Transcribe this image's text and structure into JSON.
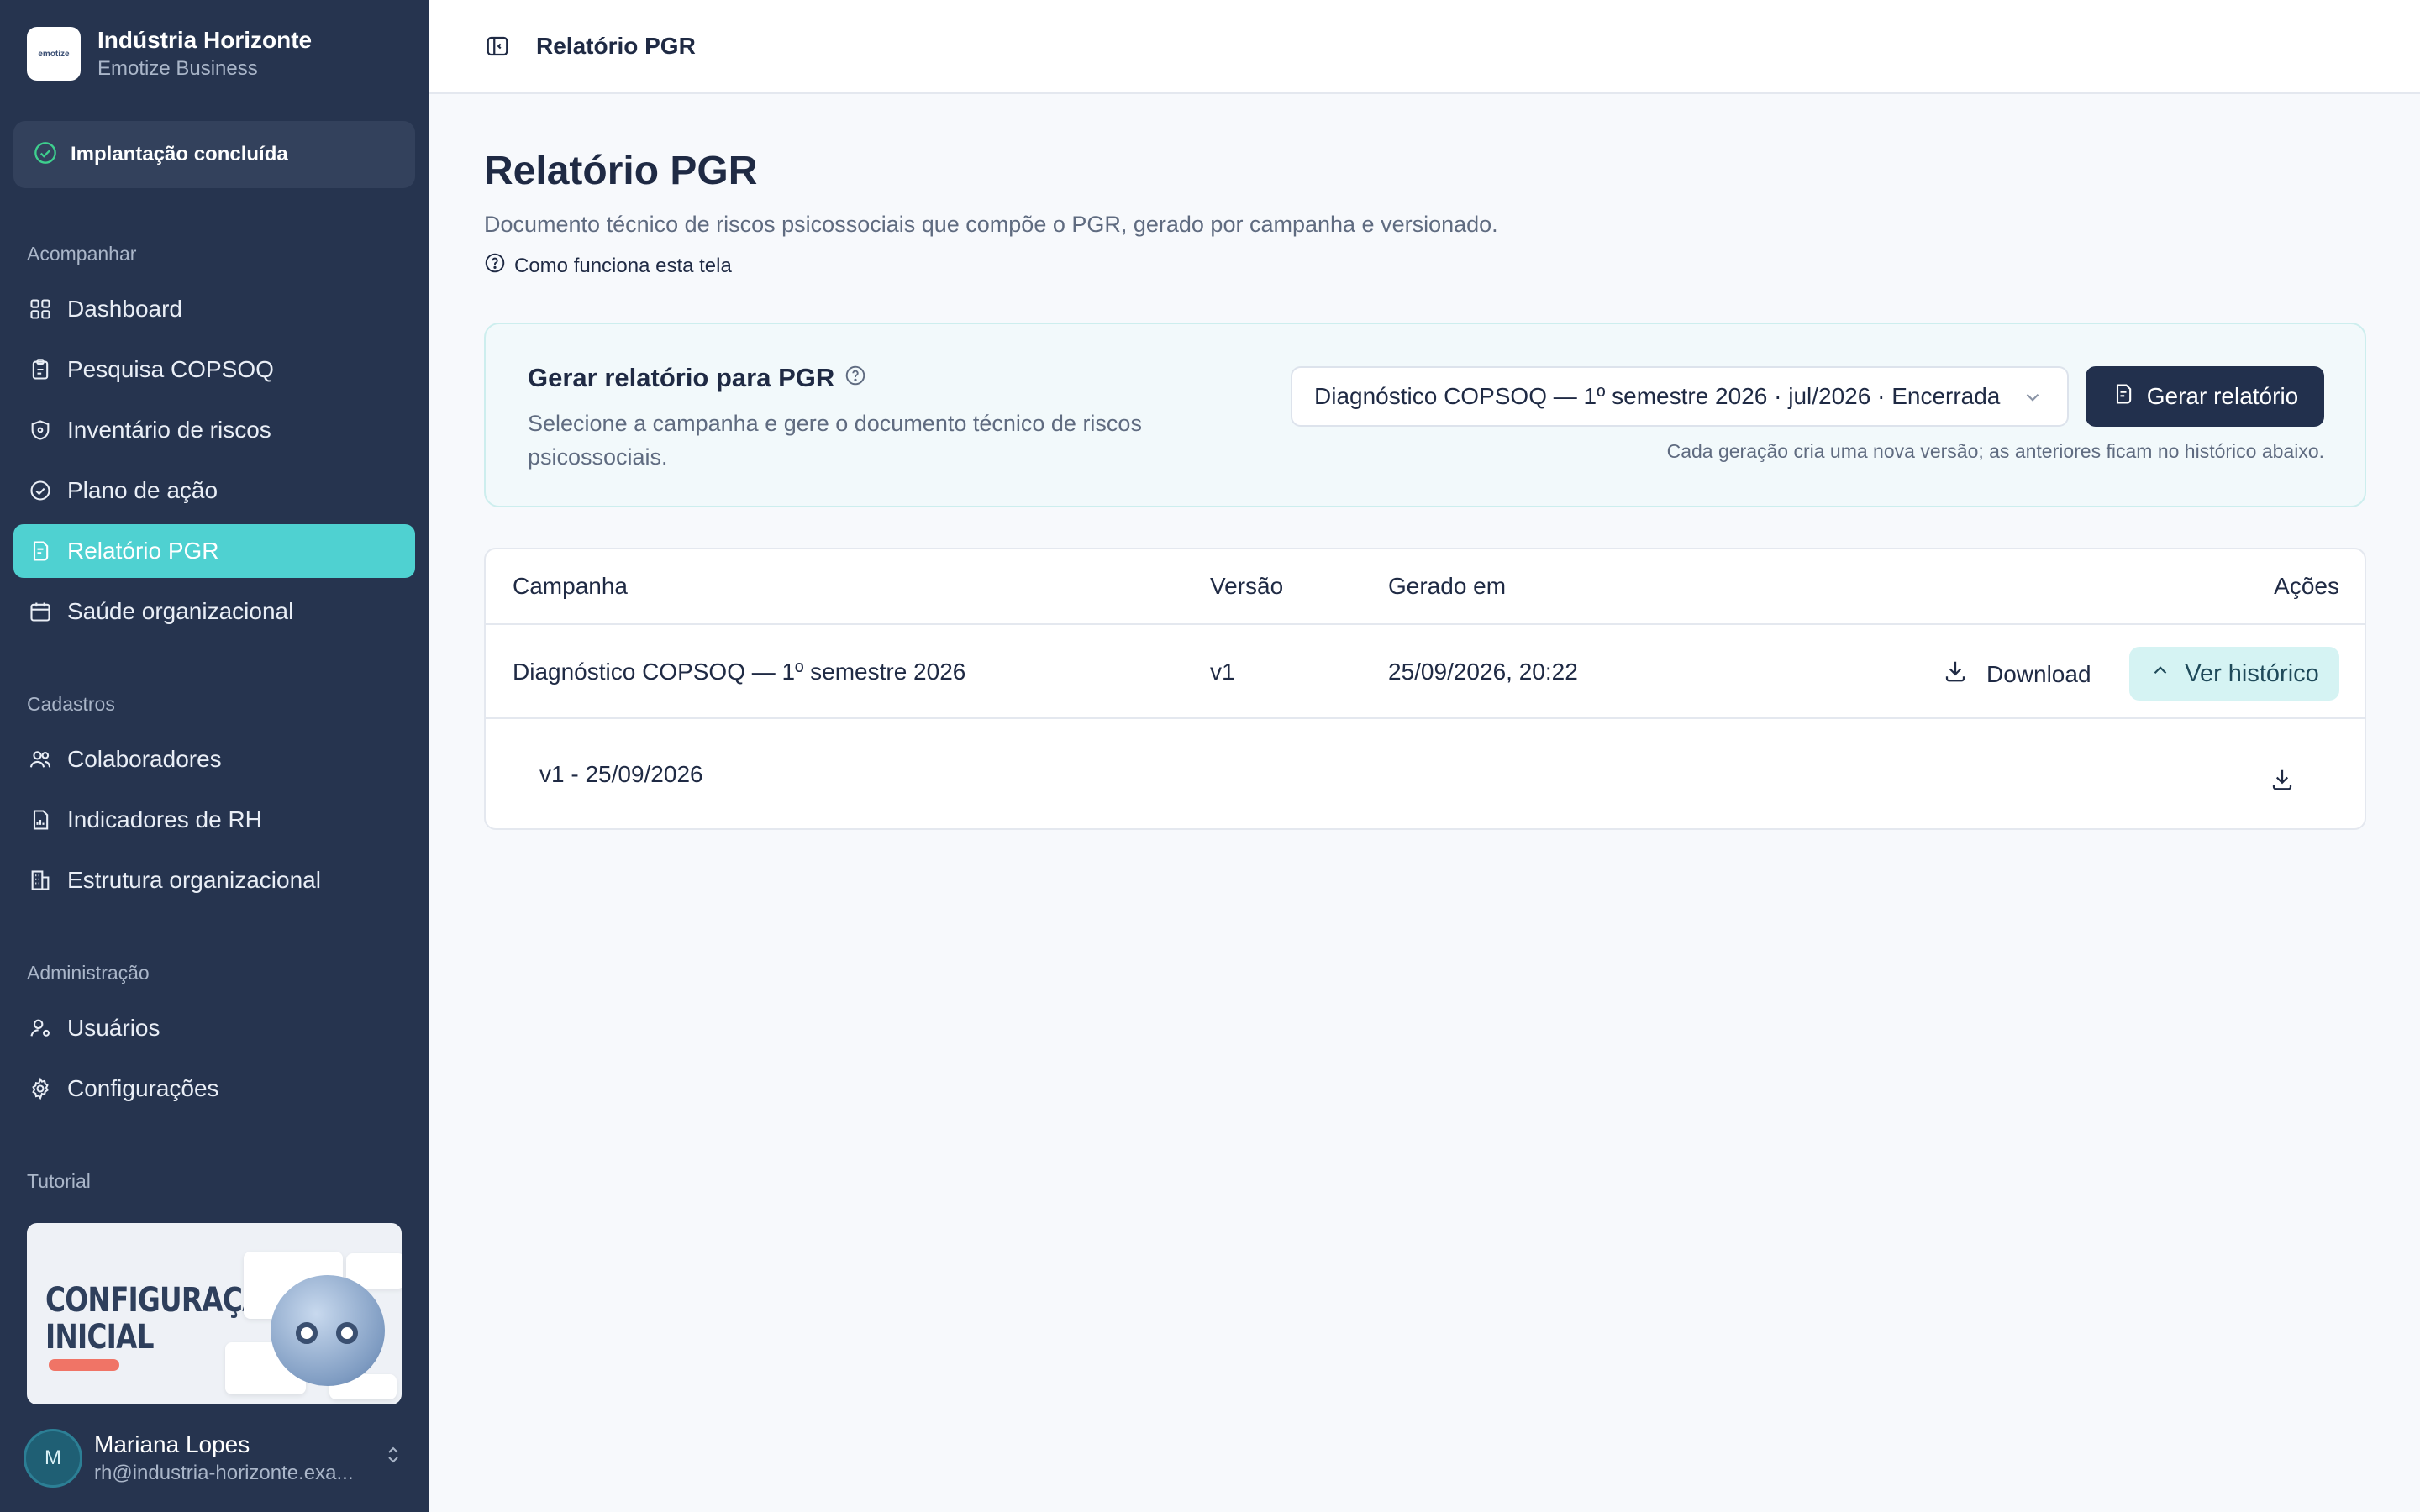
{
  "brand": {
    "name": "Indústria Horizonte",
    "subtitle": "Emotize Business",
    "logo_text": "emotize"
  },
  "status": {
    "label": "Implantação concluída"
  },
  "sidebar": {
    "sections": [
      {
        "label": "Acompanhar"
      },
      {
        "label": "Cadastros"
      },
      {
        "label": "Administração"
      },
      {
        "label": "Tutorial"
      }
    ],
    "items": [
      {
        "label": "Dashboard",
        "icon": "grid-icon"
      },
      {
        "label": "Pesquisa COPSOQ",
        "icon": "clipboard-icon"
      },
      {
        "label": "Inventário de riscos",
        "icon": "shield-icon"
      },
      {
        "label": "Plano de ação",
        "icon": "check-circle-icon"
      },
      {
        "label": "Relatório PGR",
        "icon": "file-icon",
        "active": true
      },
      {
        "label": "Saúde organizacional",
        "icon": "calendar-icon"
      },
      {
        "label": "Colaboradores",
        "icon": "users-icon"
      },
      {
        "label": "Indicadores de RH",
        "icon": "file-chart-icon"
      },
      {
        "label": "Estrutura organizacional",
        "icon": "building-icon"
      },
      {
        "label": "Usuários",
        "icon": "user-cog-icon"
      },
      {
        "label": "Configurações",
        "icon": "gear-icon"
      }
    ],
    "tutorial": {
      "title_line1": "CONFIGURAÇÃO",
      "title_line2": "INICIAL"
    }
  },
  "user": {
    "initial": "M",
    "name": "Mariana Lopes",
    "email": "rh@industria-horizonte.exa..."
  },
  "topbar": {
    "breadcrumb": "Relatório PGR"
  },
  "page": {
    "title": "Relatório PGR",
    "description": "Documento técnico de riscos psicossociais que compõe o PGR, gerado por campanha e versionado.",
    "help_link": "Como funciona esta tela"
  },
  "generate": {
    "title": "Gerar relatório para PGR",
    "description": "Selecione a campanha e gere o documento técnico de riscos psicossociais.",
    "selected_campaign": "Diagnóstico COPSOQ — 1º semestre 2026 · jul/2026 · Encerrada",
    "button_label": "Gerar relatório",
    "note": "Cada geração cria uma nova versão; as anteriores ficam no histórico abaixo."
  },
  "table": {
    "headers": {
      "campaign": "Campanha",
      "version": "Versão",
      "generated_at": "Gerado em",
      "actions": "Ações"
    },
    "rows": [
      {
        "campaign": "Diagnóstico COPSOQ — 1º semestre 2026",
        "version": "v1",
        "generated_at": "25/09/2026, 20:22",
        "download_label": "Download",
        "history_label": "Ver histórico"
      }
    ],
    "history": [
      {
        "label": "v1 - 25/09/2026"
      }
    ]
  },
  "colors": {
    "sidebar_bg": "#26344f",
    "accent": "#4fd1d1",
    "primary_button": "#22304d",
    "history_button": "#d5f3f3"
  }
}
